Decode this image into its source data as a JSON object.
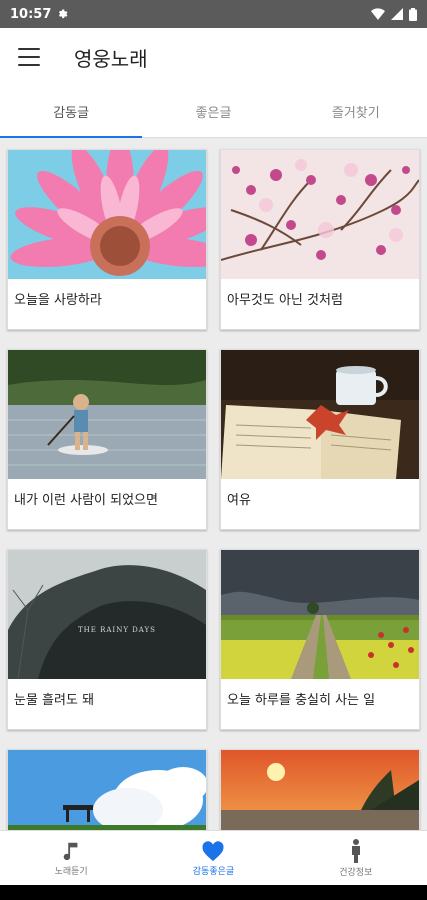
{
  "status": {
    "time": "10:57"
  },
  "app": {
    "title": "영웅노래"
  },
  "tabs": [
    {
      "label": "감동글"
    },
    {
      "label": "좋은글"
    },
    {
      "label": "즐거찾기"
    }
  ],
  "cards": [
    {
      "caption": "오늘을 사랑하라"
    },
    {
      "caption": "아무것도 아닌 것처럼"
    },
    {
      "caption": "내가 이런 사람이 되었으면"
    },
    {
      "caption": "여유"
    },
    {
      "caption": "눈물 흘려도 돼"
    },
    {
      "caption": "오늘 하루를 충실히 사는 일"
    },
    {
      "caption": ""
    },
    {
      "caption": ""
    }
  ],
  "images": {
    "card3_overlay_text": "THE RAINY DAYS"
  },
  "bottom_nav": [
    {
      "label": "노래듣기"
    },
    {
      "label": "감동좋은글"
    },
    {
      "label": "건강정보"
    }
  ],
  "colors": {
    "accent": "#1a73e8",
    "status_bar": "#5b5b5b"
  }
}
